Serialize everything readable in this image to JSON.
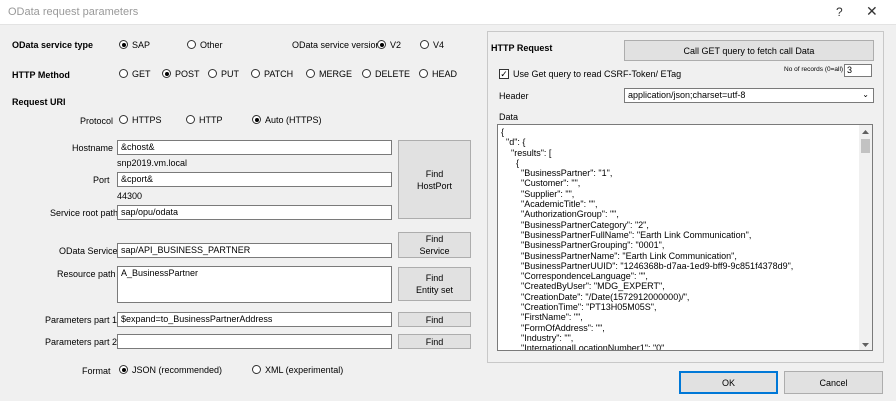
{
  "window": {
    "title": "OData request parameters",
    "help": "?",
    "close": "✕"
  },
  "service_type": {
    "label": "OData service type",
    "options": [
      "SAP",
      "Other"
    ],
    "selected": "SAP"
  },
  "service_version": {
    "label": "OData service version",
    "options": [
      "V2",
      "V4"
    ],
    "selected": "V2"
  },
  "http_method": {
    "label": "HTTP Method",
    "options": [
      "GET",
      "POST",
      "PUT",
      "PATCH",
      "MERGE",
      "DELETE",
      "HEAD"
    ],
    "selected": "POST"
  },
  "request_uri": {
    "label": "Request URI"
  },
  "protocol": {
    "label": "Protocol",
    "options": [
      "HTTPS",
      "HTTP",
      "Auto (HTTPS)"
    ],
    "selected": "Auto (HTTPS)"
  },
  "hostname": {
    "label": "Hostname",
    "value": "&chost&",
    "resolved": "snp2019.vm.local"
  },
  "port": {
    "label": "Port",
    "value": "&cport&",
    "resolved": "44300"
  },
  "find_hostport": {
    "line1": "Find",
    "line2": "HostPort"
  },
  "service_root": {
    "label": "Service root path",
    "value": "sap/opu/odata"
  },
  "odata_service": {
    "label": "OData Service",
    "value": "sap/API_BUSINESS_PARTNER"
  },
  "find_service": {
    "line1": "Find",
    "line2": "Service"
  },
  "resource_path": {
    "label": "Resource path",
    "value": "A_BusinessPartner"
  },
  "find_entity": {
    "line1": "Find",
    "line2": "Entity set"
  },
  "params1": {
    "label": "Parameters part 1",
    "value": "$expand=to_BusinessPartnerAddress",
    "find": "Find"
  },
  "params2": {
    "label": "Parameters part 2",
    "value": "",
    "find": "Find"
  },
  "format": {
    "label": "Format",
    "options": [
      "JSON (recommended)",
      "XML (experimental)"
    ],
    "selected": "JSON (recommended)"
  },
  "http_request": {
    "title": "HTTP Request",
    "call_get": "Call GET query to fetch call Data",
    "records_label": "No of records (0=all)",
    "records_value": "3",
    "use_get_label": "Use Get query to read CSRF-Token/ ETag",
    "use_get_checked": true,
    "header_label": "Header",
    "header_value": "application/json;charset=utf-8",
    "data_label": "Data",
    "data_lines": [
      "{",
      "  \"d\": {",
      "    \"results\": [",
      "      {",
      "        \"BusinessPartner\": \"1\",",
      "        \"Customer\": \"\",",
      "        \"Supplier\": \"\",",
      "        \"AcademicTitle\": \"\",",
      "        \"AuthorizationGroup\": \"\",",
      "        \"BusinessPartnerCategory\": \"2\",",
      "        \"BusinessPartnerFullName\": \"Earth Link Communication\",",
      "        \"BusinessPartnerGrouping\": \"0001\",",
      "        \"BusinessPartnerName\": \"Earth Link Communication\",",
      "        \"BusinessPartnerUUID\": \"1246368b-d7aa-1ed9-bff9-9c851f4378d9\",",
      "        \"CorrespondenceLanguage\": \"\",",
      "        \"CreatedByUser\": \"MDG_EXPERT\",",
      "        \"CreationDate\": \"/Date(1572912000000)/\",",
      "        \"CreationTime\": \"PT13H05M05S\",",
      "        \"FirstName\": \"\",",
      "        \"FormOfAddress\": \"\",",
      "        \"Industry\": \"\",",
      "        \"InternationalLocationNumber1\": \"0\","
    ]
  },
  "ok": "OK",
  "cancel": "Cancel"
}
